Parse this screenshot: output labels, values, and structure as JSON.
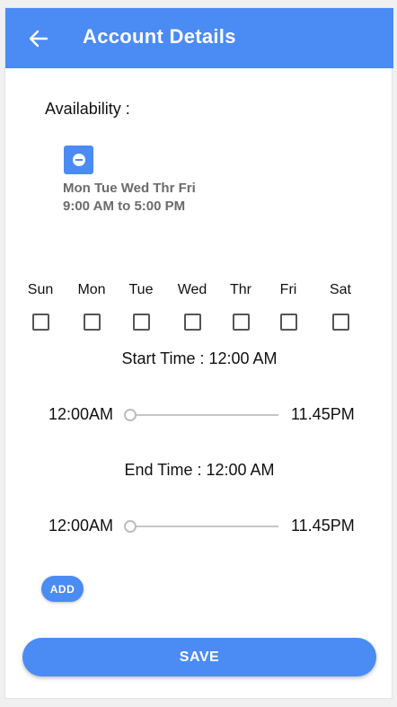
{
  "header": {
    "title": "Account Details",
    "back_icon": "arrow-left-icon",
    "background_color": "#4b8bf4"
  },
  "availability": {
    "label": "Availability :",
    "remove_icon": "minus-circle-icon",
    "entries": [
      {
        "days": "Mon Tue Wed Thr Fri",
        "hours": "9:00 AM to 5:00 PM"
      }
    ]
  },
  "days": [
    {
      "label": "Sun",
      "checked": false
    },
    {
      "label": "Mon",
      "checked": false
    },
    {
      "label": "Tue",
      "checked": false
    },
    {
      "label": "Wed",
      "checked": false
    },
    {
      "label": "Thr",
      "checked": false
    },
    {
      "label": "Fri",
      "checked": false
    },
    {
      "label": "Sat",
      "checked": false
    }
  ],
  "start_time": {
    "label": "Start Time : 12:00 AM",
    "min_label": "12:00AM",
    "max_label": "11.45PM",
    "value_fraction": 0
  },
  "end_time": {
    "label": "End Time : 12:00 AM",
    "min_label": "12:00AM",
    "max_label": "11.45PM",
    "value_fraction": 0
  },
  "buttons": {
    "add_label": "ADD",
    "save_label": "SAVE"
  }
}
